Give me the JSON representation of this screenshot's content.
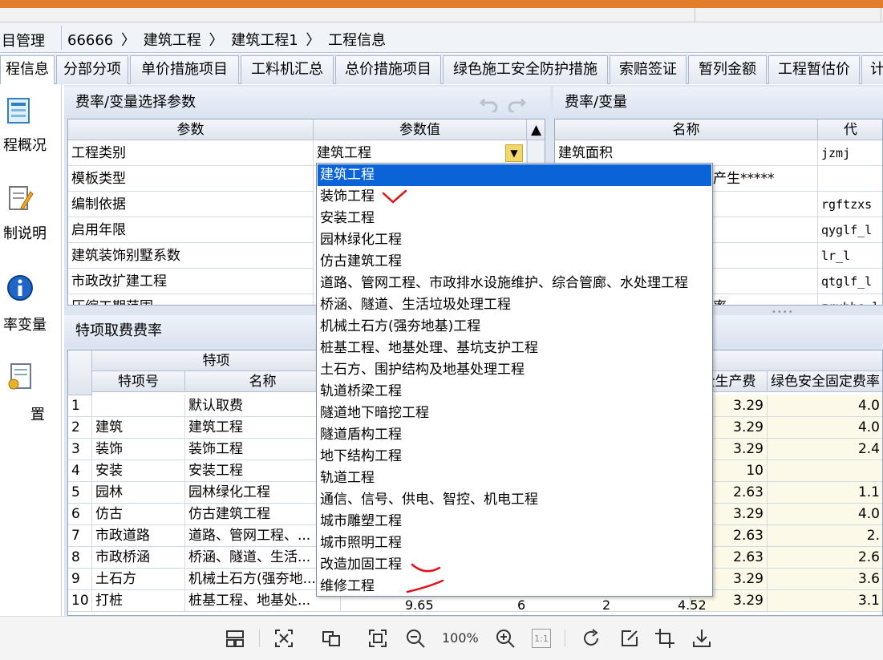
{
  "breadcrumb": {
    "section_title": "目管理",
    "path": [
      "66666",
      "建筑工程",
      "建筑工程1",
      "工程信息"
    ],
    "separator": "〉"
  },
  "left_nav": {
    "active_tab": "程信息",
    "items": [
      {
        "label": "程概况",
        "icon": "overview-icon"
      },
      {
        "label": "制说明",
        "icon": "edit-doc-icon"
      },
      {
        "label": "率变量",
        "icon": "info-icon"
      },
      {
        "label": "置",
        "icon": "settings-doc-icon"
      }
    ]
  },
  "tabs": [
    "分部分项",
    "单价措施项目",
    "工料机汇总",
    "总价措施项目",
    "绿色施工安全防护措施",
    "索赔签证",
    "暂列金额",
    "工程暂估价",
    "计"
  ],
  "param_panel": {
    "title": "费率/变量选择参数",
    "columns": [
      "参数",
      "参数值"
    ],
    "rows": [
      {
        "name": "工程类别",
        "value": "建筑工程"
      },
      {
        "name": "模板类型",
        "value": ""
      },
      {
        "name": "编制依据",
        "value": ""
      },
      {
        "name": "启用年限",
        "value": ""
      },
      {
        "name": "建筑装饰别墅系数",
        "value": ""
      },
      {
        "name": "市政改扩建工程",
        "value": ""
      },
      {
        "name": "压缩工期范围",
        "value": ""
      }
    ]
  },
  "var_panel": {
    "title": "费率/变量",
    "columns": [
      "名称",
      "代"
    ],
    "rows": [
      {
        "name": "建筑面积",
        "code": "jzmj"
      },
      {
        "name": "产生*****",
        "code": ""
      },
      {
        "name": "",
        "code": "rgftzxs"
      },
      {
        "name": "",
        "code": "qyglf_l"
      },
      {
        "name": "",
        "code": "lr_l"
      },
      {
        "name": "",
        "code": "qtglf_l"
      },
      {
        "name": "率",
        "code": "zrxbhs_l"
      }
    ]
  },
  "special_panel": {
    "title": "特项取费费率",
    "group_header": "特项",
    "columns": [
      "特项号",
      "名称"
    ],
    "right_columns": [
      "全生产费",
      "绿色安全固定费率"
    ],
    "rows": [
      {
        "no": "1",
        "code": "",
        "name": "默认取费",
        "safe": "3.29",
        "green": "4.0"
      },
      {
        "no": "2",
        "code": "建筑",
        "name": "建筑工程",
        "safe": "3.29",
        "green": "4.0"
      },
      {
        "no": "3",
        "code": "装饰",
        "name": "装饰工程",
        "safe": "3.29",
        "green": "2.4"
      },
      {
        "no": "4",
        "code": "安装",
        "name": "安装工程",
        "safe": "10",
        "green": ""
      },
      {
        "no": "5",
        "code": "园林",
        "name": "园林绿化工程",
        "safe": "2.63",
        "green": "1.1"
      },
      {
        "no": "6",
        "code": "仿古",
        "name": "仿古建筑工程",
        "safe": "3.29",
        "green": "4.0"
      },
      {
        "no": "7",
        "code": "市政道路",
        "name": "道路、管网工程、...",
        "safe": "2.63",
        "green": "2."
      },
      {
        "no": "8",
        "code": "市政桥涵",
        "name": "桥涵、隧道、生活...",
        "safe": "2.63",
        "green": "2.6"
      },
      {
        "no": "9",
        "code": "土石方",
        "name": "机械土石方(强夯地...",
        "safe": "3.29",
        "green": "3.6"
      },
      {
        "no": "10",
        "code": "打桩",
        "name": "桩基工程、地基处...",
        "safe": "3.29",
        "green": "3.1"
      }
    ],
    "last_row_partial": [
      "9.65",
      "6",
      "2",
      "4.52"
    ]
  },
  "dropdown": {
    "selected": "建筑工程",
    "options": [
      "建筑工程",
      "装饰工程",
      "安装工程",
      "园林绿化工程",
      "仿古建筑工程",
      "道路、管网工程、市政排水设施维护、综合管廊、水处理工程",
      "桥涵、隧道、生活垃圾处理工程",
      "机械土石方(强夯地基)工程",
      "桩基工程、地基处理、基坑支护工程",
      "土石方、围护结构及地基处理工程",
      "轨道桥梁工程",
      "隧道地下暗挖工程",
      "隧道盾构工程",
      "地下结构工程",
      "轨道工程",
      "通信、信号、供电、智控、机电工程",
      "城市雕塑工程",
      "城市照明工程",
      "改造加固工程",
      "维修工程"
    ]
  },
  "viewer": {
    "zoom": "100%",
    "one_to_one": "1:1",
    "annotation_color": "#e0121a"
  }
}
